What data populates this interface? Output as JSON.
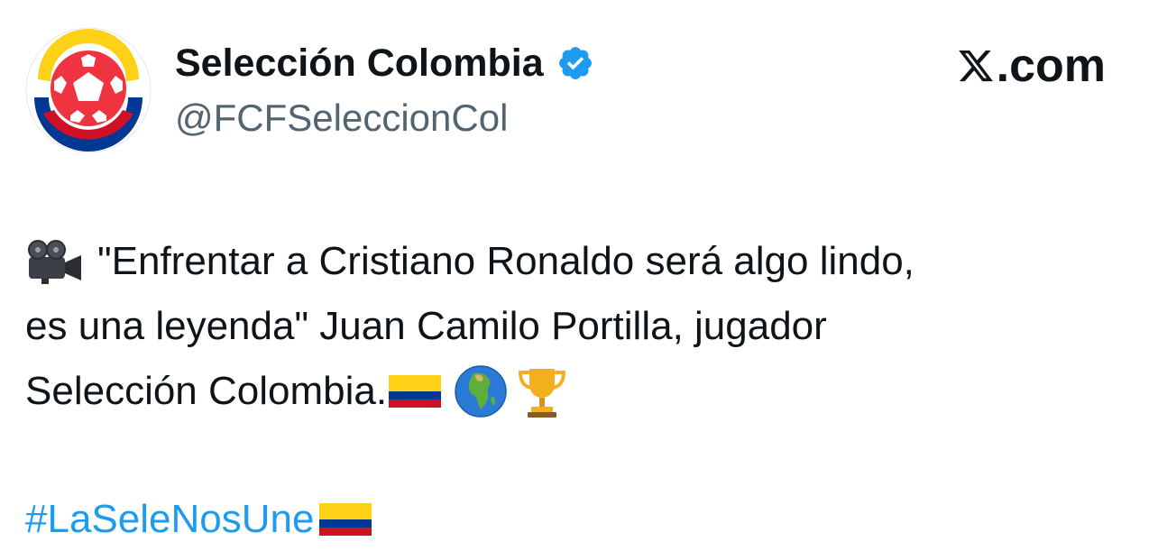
{
  "account": {
    "display_name": "Selección Colombia",
    "handle": "@FCFSeleccionCol",
    "verified": true
  },
  "brand": {
    "label": ".com",
    "logo_icon": "x-logo-icon"
  },
  "tweet": {
    "lines": [
      "\"Enfrentar a Cristiano Ronaldo será algo lindo,",
      "es una leyenda\" Juan Camilo Portilla, jugador",
      "Selección Colombia."
    ],
    "hashtag": "#LaSeleNosUne",
    "emojis": [
      "movie-camera-icon",
      "colombia-flag-icon",
      "globe-africa-icon",
      "trophy-icon"
    ]
  },
  "colors": {
    "hashtag": "#1d9bf0",
    "verified_badge": "#1d9bf0",
    "handle": "#536471",
    "text": "#0f1419",
    "flag_yellow": "#fcd116",
    "flag_blue": "#003893",
    "flag_red": "#ce1126"
  }
}
